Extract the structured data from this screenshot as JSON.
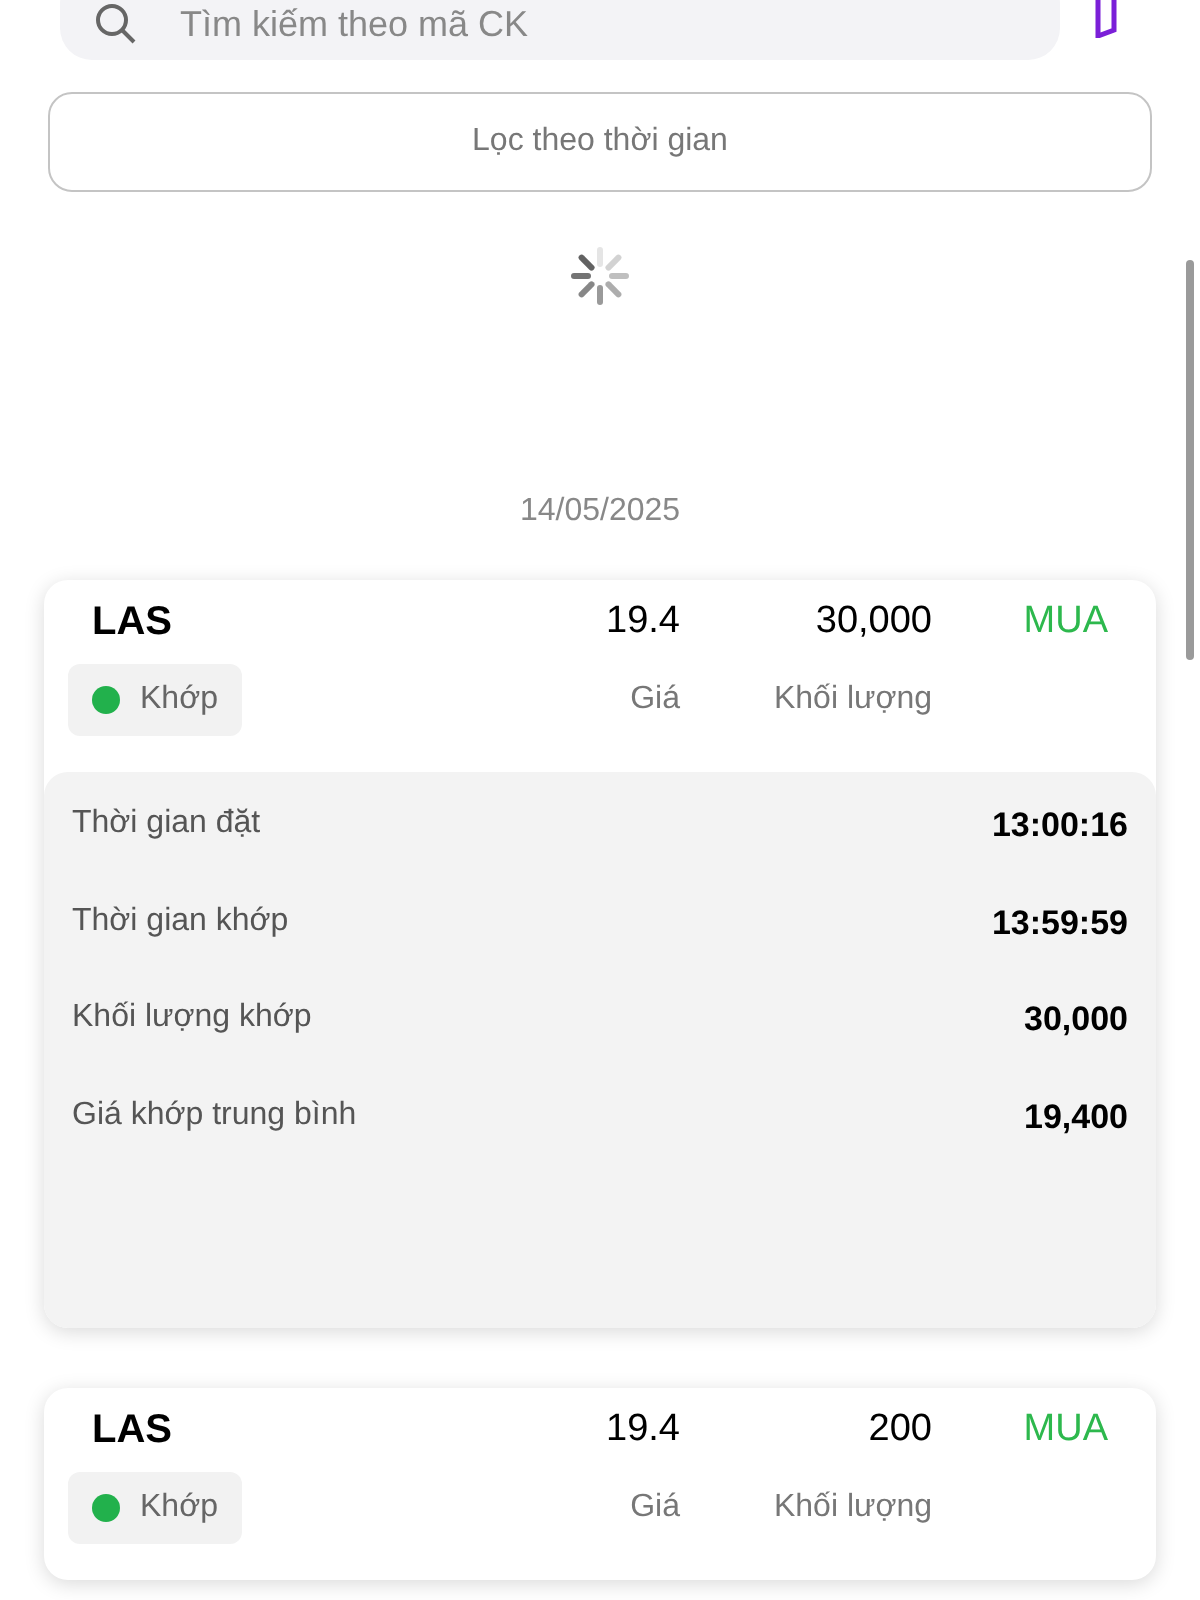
{
  "search": {
    "placeholder": "Tìm kiếm theo mã CK"
  },
  "filter_button": {
    "label": "Lọc theo thời gian"
  },
  "date": "14/05/2025",
  "orders": [
    {
      "symbol": "LAS",
      "price": "19.4",
      "volume": "30,000",
      "side": "MUA",
      "status": {
        "label": "Khớp",
        "color": "#22b14c"
      },
      "price_label": "Giá",
      "volume_label": "Khối lượng",
      "details": [
        {
          "label": "Thời gian đặt",
          "value": "13:00:16"
        },
        {
          "label": "Thời gian khớp",
          "value": "13:59:59"
        },
        {
          "label": "Khối lượng khớp",
          "value": "30,000"
        },
        {
          "label": "Giá khớp trung bình",
          "value": "19,400"
        }
      ]
    },
    {
      "symbol": "LAS",
      "price": "19.4",
      "volume": "200",
      "side": "MUA",
      "status": {
        "label": "Khớp",
        "color": "#22b14c"
      },
      "price_label": "Giá",
      "volume_label": "Khối lượng"
    }
  ]
}
